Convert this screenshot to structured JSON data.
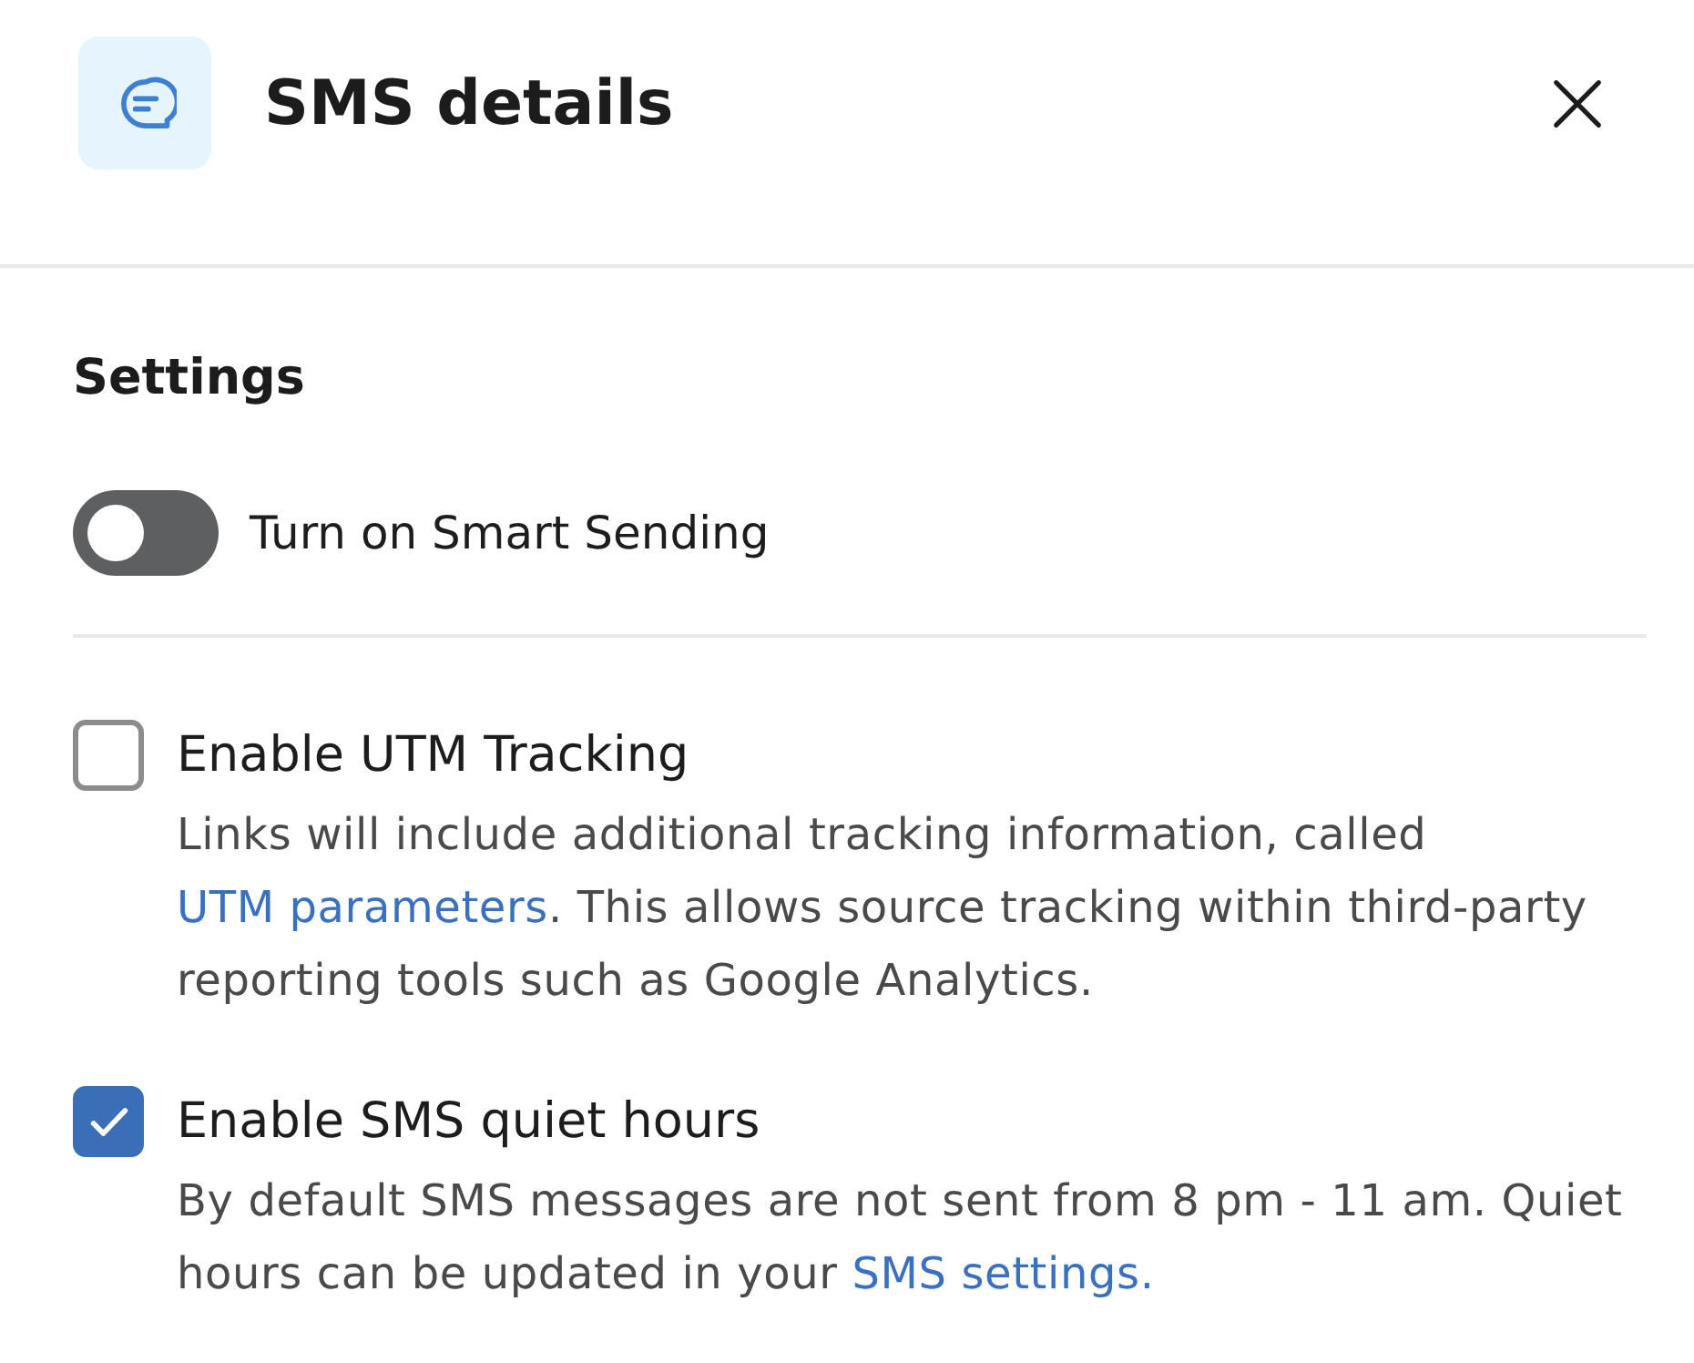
{
  "header": {
    "title": "SMS details"
  },
  "settings": {
    "title": "Settings",
    "toggle": {
      "label": "Turn on Smart Sending",
      "on": false
    },
    "checkboxes": [
      {
        "label": "Enable UTM Tracking",
        "checked": false,
        "description": {
          "before": "Links will include additional tracking information, called ",
          "link": "UTM parameters",
          "after": ". This allows source tracking within third-party reporting tools such as Google Analytics."
        }
      },
      {
        "label": "Enable SMS quiet hours",
        "checked": true,
        "description": {
          "before": "By default SMS messages are not sent from 8 pm - 11 am. Quiet hours can be updated in your ",
          "link": "SMS settings."
        }
      }
    ]
  }
}
